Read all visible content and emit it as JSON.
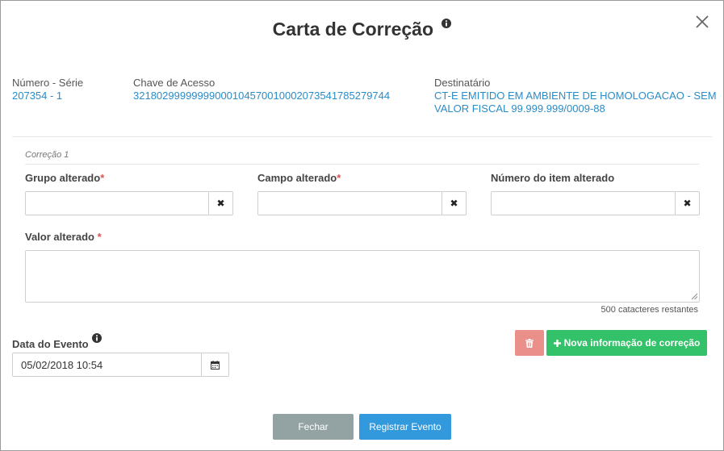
{
  "modal": {
    "title": "Carta de Correção",
    "close_icon": "close-icon"
  },
  "header": {
    "numero_label": "Número - Série",
    "numero_value": "207354 - 1",
    "chave_label": "Chave de Acesso",
    "chave_value": "32180299999999000104570010002073541785279744",
    "destinatario_label": "Destinatário",
    "destinatario_line1": "CT-E EMITIDO EM AMBIENTE DE HOMOLOGACAO - SEM",
    "destinatario_line2": "VALOR FISCAL 99.999.999/0009-88"
  },
  "correction": {
    "legend": "Correção 1",
    "grupo_label": "Grupo alterado",
    "campo_label": "Campo alterado",
    "item_label": "Número do item alterado",
    "valor_label": "Valor alterado",
    "required_mark": "*",
    "clear_glyph": "✖",
    "grupo_value": "",
    "campo_value": "",
    "item_value": "",
    "valor_value": "",
    "char_count": "500 catacteres restantes"
  },
  "event": {
    "date_label": "Data do Evento",
    "date_value": "05/02/2018 10:54"
  },
  "buttons": {
    "new_info": "Nova informação de correção",
    "close": "Fechar",
    "register": "Registrar Evento"
  },
  "colors": {
    "link": "#2a8cc8",
    "danger": "#ea8f8a",
    "success": "#33c16a",
    "primary": "#3299dc",
    "secondary": "#93a3a3",
    "required": "#d9534f"
  }
}
